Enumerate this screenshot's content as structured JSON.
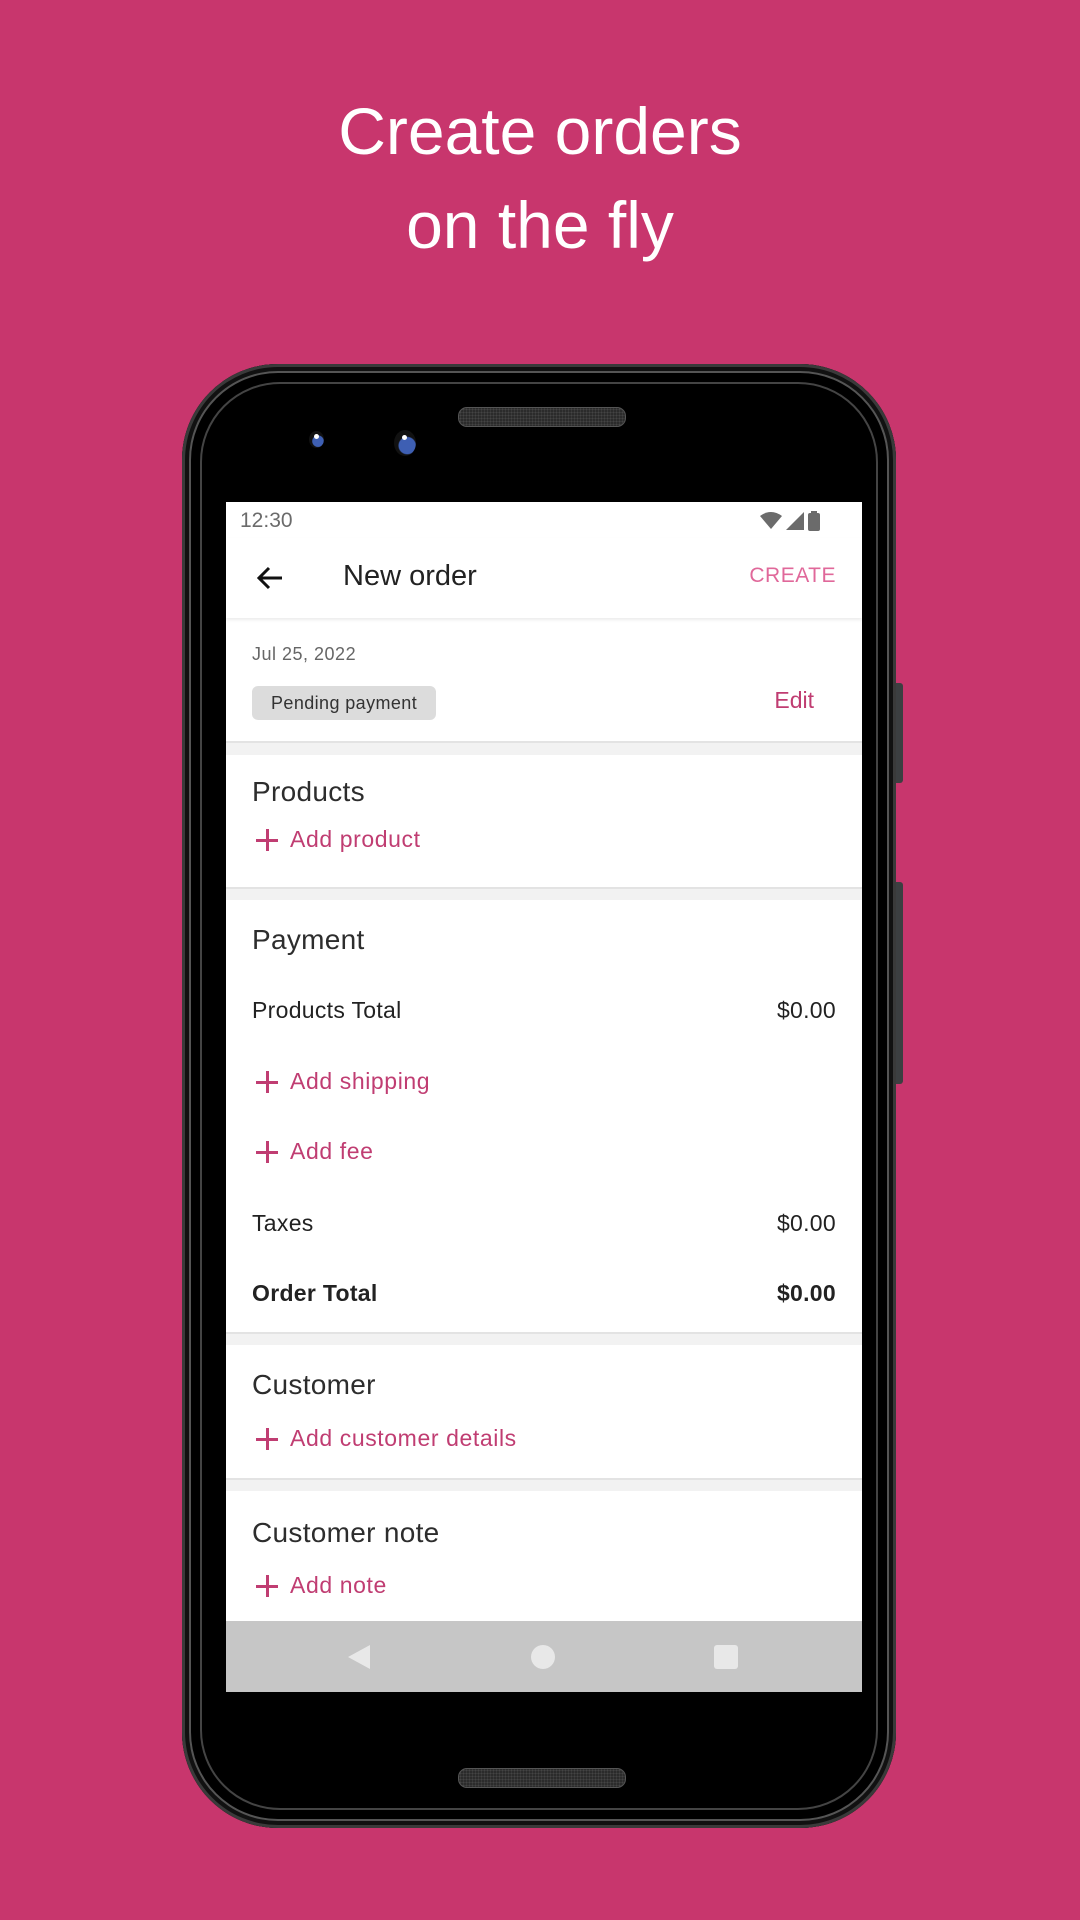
{
  "headline": {
    "line1": "Create orders",
    "line2": "on the fly"
  },
  "colors": {
    "background": "#c8366d",
    "accent": "#c03d72",
    "accent_light": "#e0689a",
    "chip_bg": "#dcdcdc"
  },
  "status_bar": {
    "time": "12:30",
    "icons": [
      "wifi-icon",
      "signal-icon",
      "battery-icon"
    ]
  },
  "toolbar": {
    "back_icon": "arrow-left-icon",
    "title": "New order",
    "create_label": "CREATE"
  },
  "order_info": {
    "date": "Jul 25, 2022",
    "status": "Pending payment",
    "edit_label": "Edit"
  },
  "products": {
    "title": "Products",
    "add_label": "Add product"
  },
  "payment": {
    "title": "Payment",
    "products_total_label": "Products Total",
    "products_total_value": "$0.00",
    "add_shipping_label": "Add shipping",
    "add_fee_label": "Add fee",
    "taxes_label": "Taxes",
    "taxes_value": "$0.00",
    "order_total_label": "Order Total",
    "order_total_value": "$0.00"
  },
  "customer": {
    "title": "Customer",
    "add_label": "Add customer details"
  },
  "customer_note": {
    "title": "Customer note",
    "add_label": "Add note"
  },
  "nav_bar": {
    "buttons": [
      "back-triangle-icon",
      "home-circle-icon",
      "recents-square-icon"
    ]
  }
}
